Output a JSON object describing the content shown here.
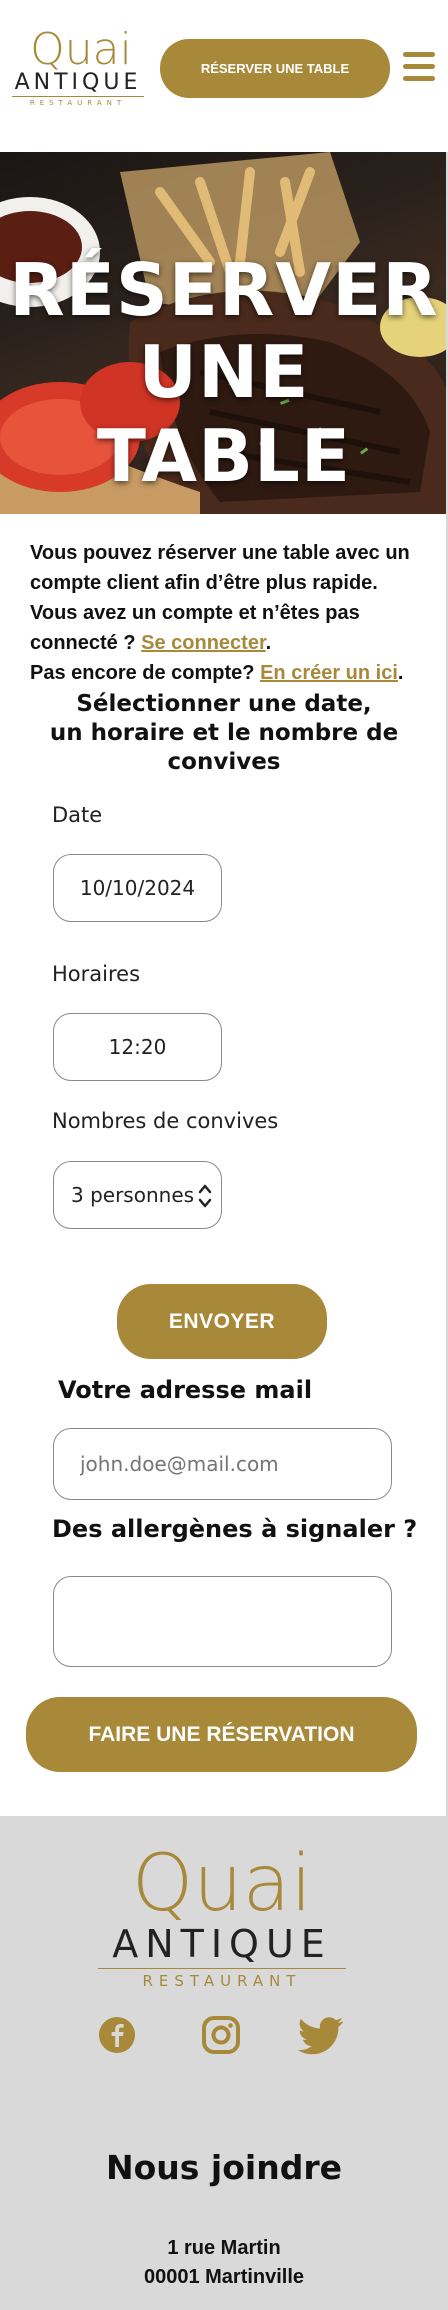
{
  "header": {
    "logo": {
      "line1": "Quai",
      "line2": "ANTIQUE",
      "line3": "RESTAURANT"
    },
    "cta_label": "RÉSERVER UNE TABLE",
    "menu_icon": "hamburger-icon"
  },
  "hero": {
    "title_line1": "RÉSERVER",
    "title_line2": "UNE TABLE"
  },
  "intro": {
    "line1": "Vous pouvez réserver une table avec un compte client afin d’être plus rapide.",
    "line2_prefix": "Vous avez un compte et n’êtes pas connecté ? ",
    "login_link": "Se connecter",
    "line2_suffix": ".",
    "line3_prefix": "Pas encore de compte? ",
    "signup_link": "En créer un ici",
    "line3_suffix": "."
  },
  "form": {
    "title_line1": "Sélectionner une date,",
    "title_line2": "un horaire et le nombre de",
    "title_line3": "convives",
    "date_label": "Date",
    "date_value": "10/10/2024",
    "time_label": "Horaires",
    "time_value": "12:20",
    "guests_label": "Nombres de convives",
    "guests_value": "3 personnes",
    "submit_label": "ENVOYER",
    "email_label": "Votre adresse mail",
    "email_placeholder": "john.doe@mail.com",
    "allergies_label": "Des allergènes à signaler ?",
    "allergies_value": "",
    "reserve_label": "FAIRE UNE RÉSERVATION"
  },
  "footer": {
    "logo": {
      "line1": "Quai",
      "line2": "ANTIQUE",
      "line3": "RESTAURANT"
    },
    "social_icons": [
      "facebook-icon",
      "instagram-icon",
      "twitter-icon"
    ],
    "contact_title": "Nous joindre",
    "address_line1": "1 rue Martin",
    "address_line2": "00001 Martinville"
  },
  "colors": {
    "accent": "#a8893a",
    "footer_bg": "#d9d9d9",
    "text": "#111111"
  }
}
